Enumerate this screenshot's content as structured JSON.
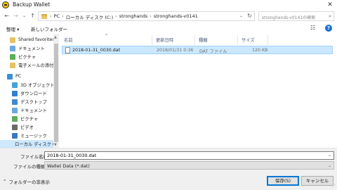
{
  "window": {
    "title": "Backup Wallet",
    "close_glyph": "✕"
  },
  "address": {
    "crumbs": [
      "PC",
      "ローカル ディスク (C:)",
      "stronghands",
      "stronghands-v0141"
    ],
    "separator": "›",
    "search_placeholder": "stronghands-v0141の検索"
  },
  "toolbar": {
    "organize": "整理 ▾",
    "new_folder": "新しいフォルダー",
    "help": "?"
  },
  "nav_pane": {
    "items": [
      {
        "label": "Shared favorites",
        "icon": "folder-icon",
        "color": "#e8c265"
      },
      {
        "label": "ドキュメント",
        "icon": "documents-icon",
        "color": "#6aa8e0"
      },
      {
        "label": "ピクチャ",
        "icon": "pictures-icon",
        "color": "#5cae5a"
      },
      {
        "label": "電子メールの添付",
        "icon": "mail-attachment-icon",
        "color": "#e8c265"
      },
      {
        "label": "PC",
        "icon": "pc-icon",
        "color": "#3d8fd8"
      },
      {
        "label": "3D オブジェクト",
        "icon": "3d-objects-icon",
        "color": "#45a2d8"
      },
      {
        "label": "ダウンロード",
        "icon": "downloads-icon",
        "color": "#2f80cf"
      },
      {
        "label": "デスクトップ",
        "icon": "desktop-icon",
        "color": "#3f8ad0"
      },
      {
        "label": "ドキュメント",
        "icon": "documents-icon",
        "color": "#6aa8e0"
      },
      {
        "label": "ピクチャ",
        "icon": "pictures-icon",
        "color": "#5cae5a"
      },
      {
        "label": "ビデオ",
        "icon": "videos-icon",
        "color": "#6a6a6a"
      },
      {
        "label": "ミュージック",
        "icon": "music-icon",
        "color": "#3b78c2"
      },
      {
        "label": "ローカル ディスク (C",
        "icon": "local-disk-icon",
        "color": "#8a9bb0"
      }
    ]
  },
  "file_list": {
    "columns": {
      "name": "名前",
      "date": "更新日時",
      "type": "種類",
      "size": "サイズ"
    },
    "rows": [
      {
        "name": "2018-01-31_0030.dat",
        "date": "2018/01/31 0:36",
        "type": "DAT ファイル",
        "size": "120 KB"
      }
    ]
  },
  "form": {
    "filename_label": "ファイル名(N):",
    "filename_value": "2018-01-31_0030.dat",
    "filetype_label": "ファイルの種類(T):",
    "filetype_value": "Wallet Data (*.dat)",
    "hide_folders": "フォルダーの非表示",
    "save": "保存(S)",
    "cancel": "キャンセル"
  },
  "colors": {
    "selection": "#cce8ff",
    "accent": "#0078d7"
  }
}
